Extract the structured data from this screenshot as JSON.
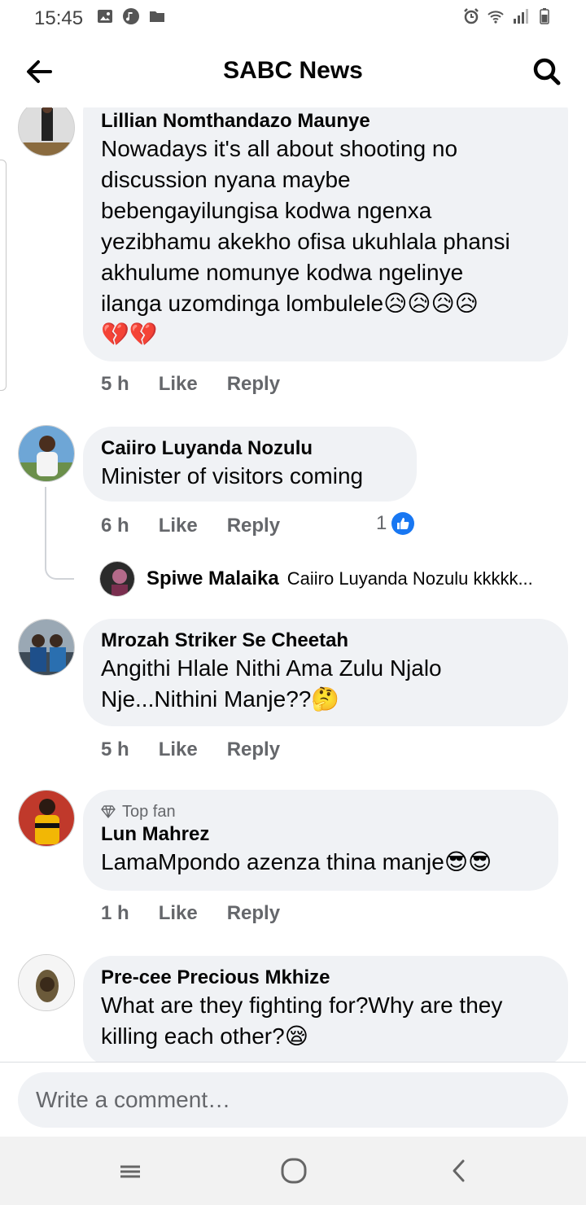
{
  "status_bar": {
    "time": "15:45",
    "left_icons": [
      "image-icon",
      "music-icon",
      "folder-icon"
    ],
    "right_icons": [
      "alarm-icon",
      "wifi-icon",
      "signal-icon",
      "battery-icon"
    ]
  },
  "header": {
    "title": "SABC News",
    "back_icon": "arrow-left-icon",
    "search_icon": "search-icon"
  },
  "comments": [
    {
      "author": "Lillian Nomthandazo Maunye",
      "lines": [
        "Nowadays it's all about shooting no",
        "discussion nyana maybe",
        "bebengayilungisa kodwa ngenxa",
        "yezibhamu akekho ofisa ukuhlala phansi",
        "akhulume nomunye kodwa ngelinye",
        "ilanga uzomdinga lombulele😥😥😥😥",
        "💔💔"
      ],
      "time": "5 h",
      "like": "Like",
      "reply": "Reply"
    },
    {
      "author": "Caiiro Luyanda Nozulu",
      "lines": [
        "Minister of visitors coming"
      ],
      "time": "6 h",
      "like": "Like",
      "reply": "Reply",
      "reaction_count": "1",
      "reply_preview": {
        "author": "Spiwe Malaika",
        "text": "Caiiro Luyanda Nozulu kkkkk..."
      }
    },
    {
      "author": "Mrozah Striker Se Cheetah",
      "lines": [
        "Angithi Hlale Nithi Ama Zulu Njalo",
        "Nje...Nithini Manje??🤔"
      ],
      "time": "5 h",
      "like": "Like",
      "reply": "Reply"
    },
    {
      "badge": "Top fan",
      "author": "Lun Mahrez",
      "lines": [
        "LamaMpondo azenza thina manje😎😎"
      ],
      "time": "1 h",
      "like": "Like",
      "reply": "Reply"
    },
    {
      "author": "Pre-cee Precious Mkhize",
      "lines": [
        "What are they fighting for?Why are they",
        "killing each other?😪"
      ]
    }
  ],
  "composer": {
    "placeholder": "Write a comment…"
  },
  "nav": {
    "icons": [
      "recent-apps-icon",
      "home-icon",
      "back-icon"
    ]
  },
  "colors": {
    "bubble": "#f0f2f5",
    "secondary_text": "#65676b",
    "like_blue": "#1877f2"
  }
}
